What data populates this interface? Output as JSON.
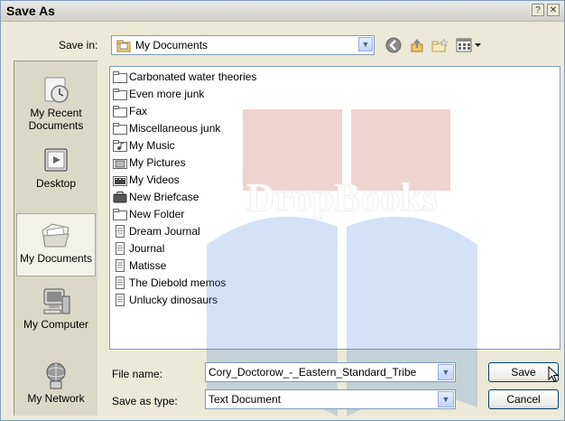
{
  "window": {
    "title": "Save As",
    "help_glyph": "?",
    "close_glyph": "✕"
  },
  "save_in": {
    "label": "Save in:",
    "value": "My Documents"
  },
  "toolbar": {
    "back_icon": "back-arrow-icon",
    "up_icon": "up-one-level-icon",
    "new_folder_icon": "new-folder-icon",
    "views_icon": "views-menu-icon"
  },
  "places": [
    {
      "label": "My Recent Documents",
      "icon": "recent-documents-icon"
    },
    {
      "label": "Desktop",
      "icon": "desktop-icon"
    },
    {
      "label": "My Documents",
      "icon": "my-documents-icon",
      "selected": true
    },
    {
      "label": "My Computer",
      "icon": "my-computer-icon"
    },
    {
      "label": "My Network",
      "icon": "my-network-icon"
    }
  ],
  "files": [
    {
      "name": "Carbonated water theories",
      "type": "folder"
    },
    {
      "name": "Even more junk",
      "type": "folder"
    },
    {
      "name": "Fax",
      "type": "folder"
    },
    {
      "name": "Miscellaneous junk",
      "type": "folder"
    },
    {
      "name": "My Music",
      "type": "music-folder"
    },
    {
      "name": "My Pictures",
      "type": "pictures-folder"
    },
    {
      "name": "My Videos",
      "type": "videos-folder"
    },
    {
      "name": "New Briefcase",
      "type": "briefcase"
    },
    {
      "name": "New Folder",
      "type": "folder"
    },
    {
      "name": "Dream Journal",
      "type": "text-document"
    },
    {
      "name": "Journal",
      "type": "text-document"
    },
    {
      "name": "Matisse",
      "type": "text-document"
    },
    {
      "name": "The Diebold memos",
      "type": "text-document"
    },
    {
      "name": "Unlucky dinosaurs",
      "type": "text-document"
    }
  ],
  "file_name": {
    "label": "File name:",
    "value": "Cory_Doctorow_-_Eastern_Standard_Tribe"
  },
  "save_as_type": {
    "label": "Save as type:",
    "value": "Text Document"
  },
  "buttons": {
    "save": "Save",
    "cancel": "Cancel"
  },
  "watermark": {
    "text": "DropBooks"
  },
  "colors": {
    "dialog_bg": "#ece9d8",
    "field_border": "#7f9db9",
    "folder_yellow": "#f2d27a",
    "watermark_red": "#c0392b",
    "watermark_blue": "#3b7dd8"
  }
}
